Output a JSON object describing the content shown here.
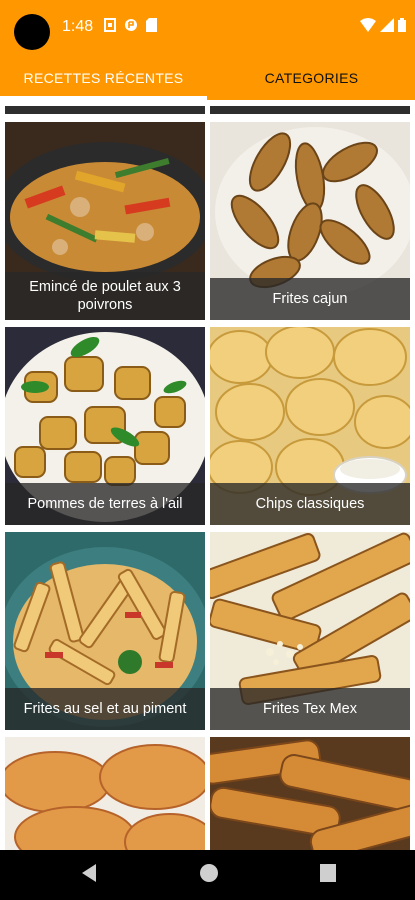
{
  "status_bar": {
    "time": "1:48"
  },
  "tabs": [
    {
      "label": "RECETTES RÉCENTES",
      "selected": true
    },
    {
      "label": "CATEGORIES",
      "selected": false
    }
  ],
  "recipes": [
    {
      "title": "Emincé de poulet aux 3 poivrons"
    },
    {
      "title": "Frites cajun"
    },
    {
      "title": "Pommes de terres à l'ail"
    },
    {
      "title": "Chips classiques"
    },
    {
      "title": "Frites au sel et au piment"
    },
    {
      "title": "Frites Tex Mex"
    }
  ],
  "colors": {
    "accent": "#FF9800",
    "caption_bg": "#282828"
  }
}
